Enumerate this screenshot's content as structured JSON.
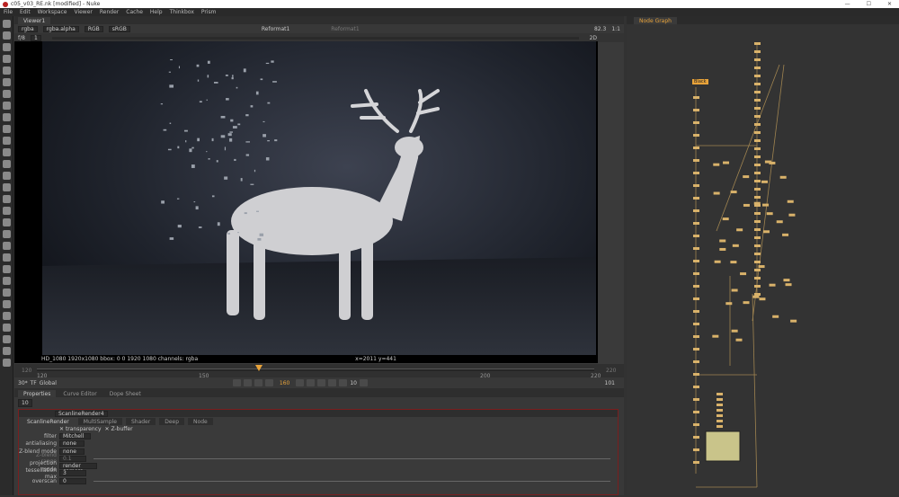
{
  "window": {
    "title": "c05_v03_RE.nk [modified] - Nuke",
    "controls": [
      "—",
      "☐",
      "✕"
    ]
  },
  "menu": [
    "File",
    "Edit",
    "Workspace",
    "Viewer",
    "Render",
    "Cache",
    "Help",
    "Thinkbox",
    "Prism"
  ],
  "viewer": {
    "tab": "Viewer1",
    "channels": "rgba",
    "alpha": "rgba.alpha",
    "colorspace": "RGB",
    "lut": "sRGB",
    "input_a": "Reformat1",
    "input_b": "Reformat1",
    "zoom": "82.3",
    "ratio": "1:1",
    "mode": "2D",
    "frame_label": "f/8",
    "frame_val": "1",
    "info": "HD_1080 1920x1080  bbox: 0 0 1920 1080 channels: rgba",
    "coords": "x=2011 y=441"
  },
  "timeline": {
    "start": "120",
    "end": "220",
    "ticks": [
      "120",
      "150",
      "200",
      "220"
    ],
    "current": "160",
    "fps": "30*",
    "tf": "TF",
    "scope": "Global",
    "step": "10",
    "out": "101"
  },
  "props": {
    "tabs": [
      "Properties",
      "Curve Editor",
      "Dope Sheet"
    ],
    "max_panels": "10",
    "node_name": "ScanlineRender4",
    "node_tabs": [
      "ScanlineRender",
      "MultiSample",
      "Shader",
      "Deep",
      "Node"
    ],
    "checks": [
      "transparency",
      "Z-buffer"
    ],
    "fields": [
      {
        "label": "filter",
        "value": "Mitchell"
      },
      {
        "label": "antialiasing",
        "value": "none"
      },
      {
        "label": "Z-blend mode",
        "value": "none"
      },
      {
        "label": "Z-blend range",
        "value": "0.1"
      },
      {
        "label": "projection mode",
        "value": "render camera"
      },
      {
        "label": "tessellation max",
        "value": "3"
      },
      {
        "label": "overscan",
        "value": "0"
      }
    ]
  },
  "nodegraph": {
    "tab": "Node Graph",
    "label": "Black"
  },
  "colors": {
    "accent": "#e8a33a",
    "node": "#d9b26a",
    "border": "#7a1e1e"
  }
}
